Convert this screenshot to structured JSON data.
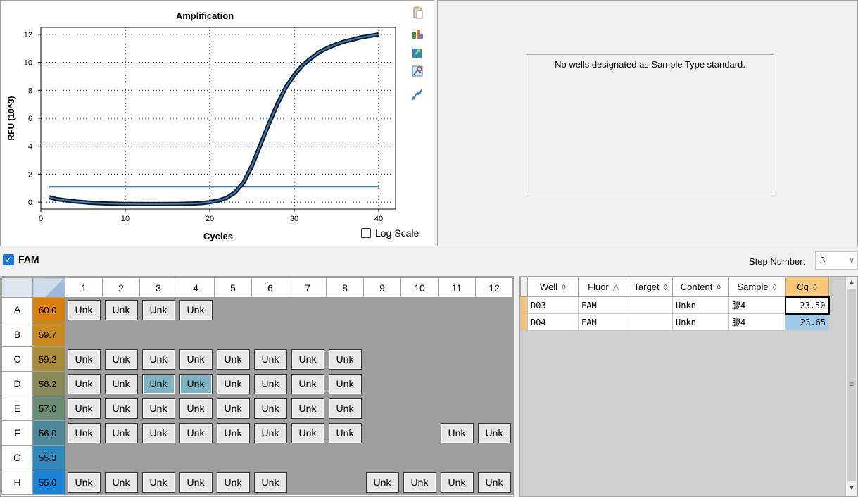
{
  "chart": {
    "title": "Amplification",
    "xlabel": "Cycles",
    "ylabel": "RFU (10^3)",
    "x_ticks": [
      "0",
      "10",
      "20",
      "30",
      "40"
    ],
    "y_ticks": [
      "0",
      "2",
      "4",
      "6",
      "8",
      "10",
      "12"
    ],
    "log_scale_label": "Log Scale",
    "log_scale_checked": false
  },
  "chart_data": {
    "type": "line",
    "title": "Amplification",
    "xlabel": "Cycles",
    "ylabel": "RFU (10^3)",
    "xlim": [
      0,
      42
    ],
    "ylim": [
      -0.5,
      12.5
    ],
    "grid": true,
    "threshold": 1.1,
    "series": [
      {
        "x": [
          1,
          2,
          4,
          6,
          8,
          10,
          12,
          14,
          16,
          18,
          19,
          20,
          21,
          22,
          23,
          24,
          25,
          26,
          27,
          28,
          29,
          30,
          31,
          32,
          33,
          34,
          35,
          36,
          37,
          38,
          39,
          40
        ],
        "values": [
          0.35,
          0.2,
          0.05,
          -0.05,
          -0.1,
          -0.13,
          -0.14,
          -0.14,
          -0.13,
          -0.1,
          -0.07,
          0.0,
          0.1,
          0.3,
          0.7,
          1.4,
          2.6,
          4.1,
          5.6,
          7.0,
          8.2,
          9.1,
          9.8,
          10.3,
          10.75,
          11.05,
          11.3,
          11.5,
          11.65,
          11.8,
          11.9,
          12.0
        ]
      }
    ]
  },
  "standard_panel": {
    "message": "No wells designated as Sample Type standard."
  },
  "fluor_bar": {
    "fluor": "FAM",
    "checked": true,
    "step_label": "Step Number:",
    "step_value": "3"
  },
  "plate": {
    "columns": [
      "1",
      "2",
      "3",
      "4",
      "5",
      "6",
      "7",
      "8",
      "9",
      "10",
      "11",
      "12"
    ],
    "rows": [
      {
        "label": "A",
        "temp": "60.0",
        "color": "#d9820f",
        "wells": [
          "Unk",
          "Unk",
          "Unk",
          "Unk",
          "",
          "",
          "",
          "",
          "",
          "",
          "",
          ""
        ],
        "selected": []
      },
      {
        "label": "B",
        "temp": "59.7",
        "color": "#c78922",
        "wells": [
          "",
          "",
          "",
          "",
          "",
          "",
          "",
          "",
          "",
          "",
          "",
          ""
        ],
        "selected": []
      },
      {
        "label": "C",
        "temp": "59.2",
        "color": "#a98b3c",
        "wells": [
          "Unk",
          "Unk",
          "Unk",
          "Unk",
          "Unk",
          "Unk",
          "Unk",
          "Unk",
          "",
          "",
          "",
          ""
        ],
        "selected": []
      },
      {
        "label": "D",
        "temp": "58.2",
        "color": "#8a8a58",
        "wells": [
          "Unk",
          "Unk",
          "Unk",
          "Unk",
          "Unk",
          "Unk",
          "Unk",
          "Unk",
          "",
          "",
          "",
          ""
        ],
        "selected": [
          2,
          3
        ]
      },
      {
        "label": "E",
        "temp": "57.0",
        "color": "#6a8a76",
        "wells": [
          "Unk",
          "Unk",
          "Unk",
          "Unk",
          "Unk",
          "Unk",
          "Unk",
          "Unk",
          "",
          "",
          "",
          ""
        ],
        "selected": []
      },
      {
        "label": "F",
        "temp": "56.0",
        "color": "#4c8898",
        "wells": [
          "Unk",
          "Unk",
          "Unk",
          "Unk",
          "Unk",
          "Unk",
          "Unk",
          "Unk",
          "",
          "",
          "Unk",
          "Unk"
        ],
        "selected": []
      },
      {
        "label": "G",
        "temp": "55.3",
        "color": "#2e86bb",
        "wells": [
          "",
          "",
          "",
          "",
          "",
          "",
          "",
          "",
          "",
          "",
          "",
          ""
        ],
        "selected": []
      },
      {
        "label": "H",
        "temp": "55.0",
        "color": "#1b84d6",
        "wells": [
          "Unk",
          "Unk",
          "Unk",
          "Unk",
          "Unk",
          "Unk",
          "",
          "",
          "Unk",
          "Unk",
          "Unk",
          "Unk"
        ],
        "selected": []
      }
    ]
  },
  "well_table": {
    "headers": [
      {
        "label": "Well",
        "sort": "◊"
      },
      {
        "label": "Fluor",
        "sort": "△"
      },
      {
        "label": "Target",
        "sort": "◊"
      },
      {
        "label": "Content",
        "sort": "◊"
      },
      {
        "label": "Sample",
        "sort": "◊"
      },
      {
        "label": "Cq",
        "sort": "◊"
      }
    ],
    "rows": [
      {
        "well": "D03",
        "fluor": "FAM",
        "target": "",
        "content": "Unkn",
        "sample": "腺4",
        "cq": "23.50"
      },
      {
        "well": "D04",
        "fluor": "FAM",
        "target": "",
        "content": "Unkn",
        "sample": "腺4",
        "cq": "23.65"
      }
    ]
  },
  "icons": {
    "toolbar": [
      "copy-icon",
      "chart-options-icon",
      "export-icon",
      "zoom-icon",
      "curve-icon"
    ]
  }
}
